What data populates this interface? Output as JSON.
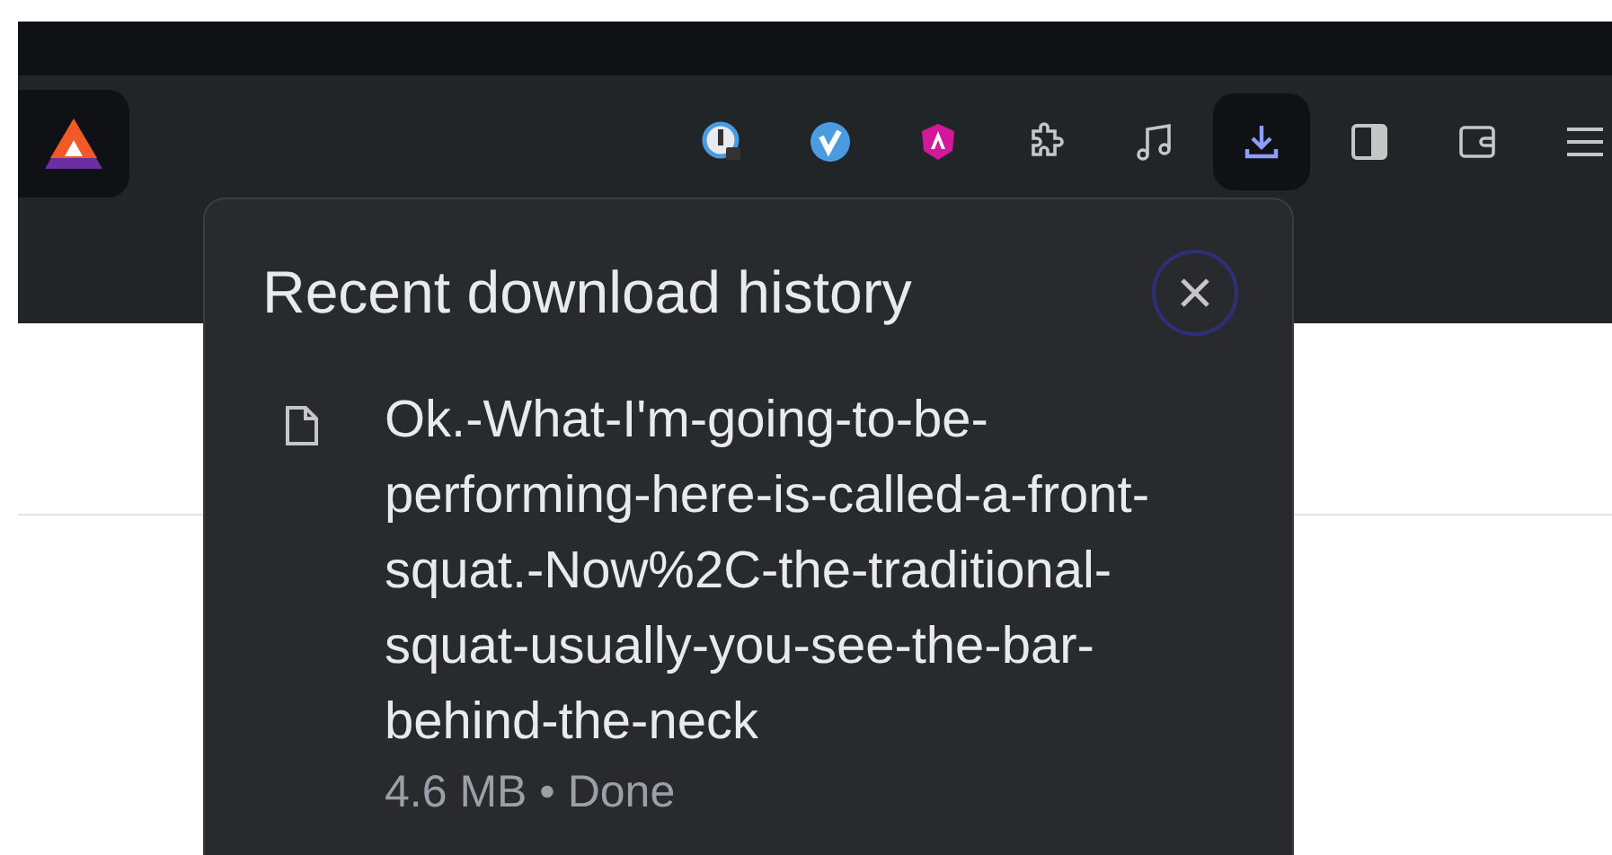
{
  "toolbar": {
    "buttons": [
      {
        "kind": "password",
        "selected": false
      },
      {
        "kind": "vpn",
        "selected": false
      },
      {
        "kind": "shield",
        "selected": false
      },
      {
        "kind": "extensions",
        "selected": false
      },
      {
        "kind": "media",
        "selected": false
      },
      {
        "kind": "downloads",
        "selected": true
      },
      {
        "kind": "sidebar",
        "selected": false
      },
      {
        "kind": "wallet",
        "selected": false
      },
      {
        "kind": "menu",
        "selected": false
      }
    ]
  },
  "downloads_popup": {
    "title": "Recent download history",
    "items": [
      {
        "filename": "Ok.-What-I'm-going-to-be-performing-here-is-called-a-front-squat.-Now%2C-the-traditional-squat-usually-you-see-the-bar-behind-the-neck",
        "status": "4.6 MB • Done"
      }
    ]
  }
}
